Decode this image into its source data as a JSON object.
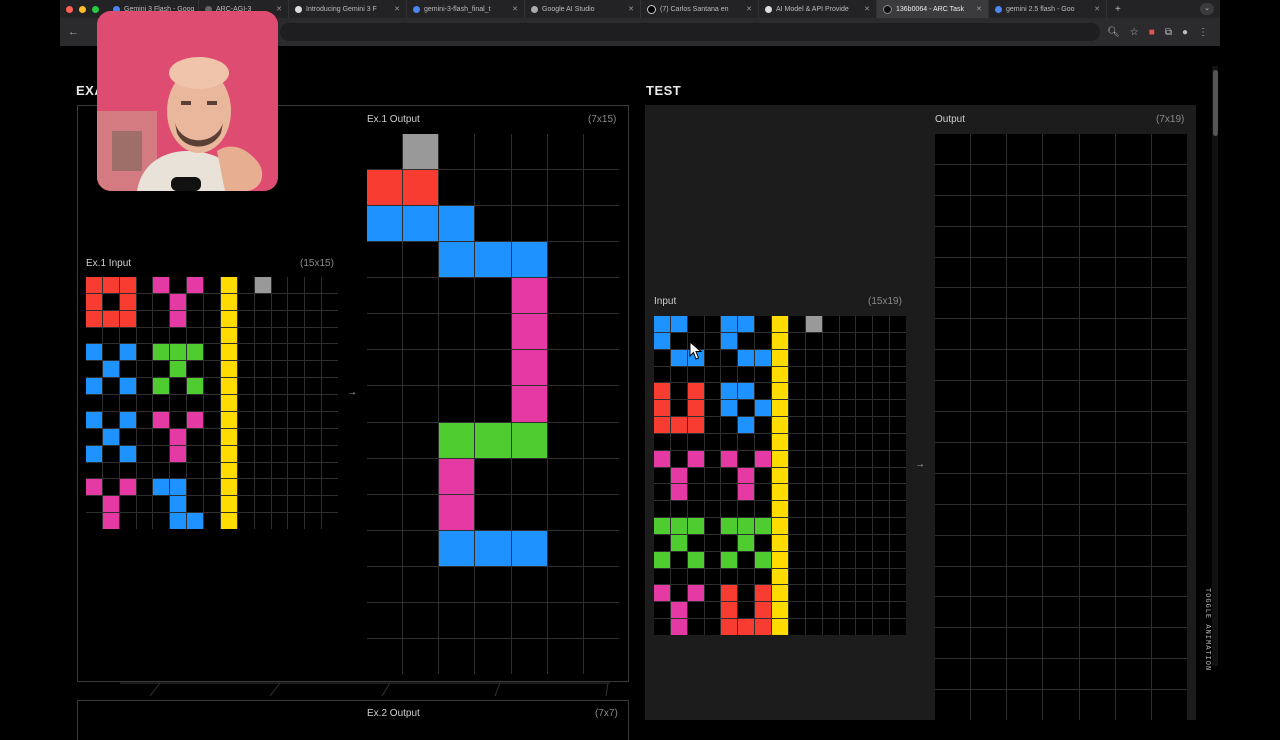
{
  "tabs": [
    {
      "label": "Gemini 3 Flash - Goog",
      "active": false
    },
    {
      "label": "ARC-AGI-3",
      "active": false
    },
    {
      "label": "Introducing Gemini 3 F",
      "active": false
    },
    {
      "label": "gemini-3-flash_final_t",
      "active": false
    },
    {
      "label": "Google AI Studio",
      "active": false
    },
    {
      "label": "(7) Carlos Santana en",
      "active": false
    },
    {
      "label": "AI Model & API Provide",
      "active": false
    },
    {
      "label": "136b0064 - ARC Task",
      "active": true
    },
    {
      "label": "gemini 2.5 flash - Goo",
      "active": false
    }
  ],
  "new_tab": "+",
  "sections": {
    "examples": "EXA",
    "test": "TEST"
  },
  "arrow": "→",
  "toggle_animation": "TOGGLE ANIMATION",
  "colors": {
    "0": "#000000",
    "1": "#1E93FF",
    "2": "#F93C31",
    "3": "#4FCC30",
    "4": "#FFDC00",
    "5": "#999999",
    "6": "#E53AA3",
    "7": "#FF851B",
    "8": "#87D8F1",
    "9": "#921231"
  },
  "grids": {
    "ex1_input": {
      "label": "Ex.1 Input",
      "dims": "(15x15)",
      "rows": [
        "222060604050000",
        "202006004000000",
        "222006004000000",
        "000000004000000",
        "101033304000000",
        "010003004000000",
        "101030304000000",
        "000000004000000",
        "101060604000000",
        "010006004000000",
        "101006004000000",
        "000000004000000",
        "606011004000000",
        "060001004000000",
        "060001104000000"
      ]
    },
    "ex1_output": {
      "label": "Ex.1 Output",
      "dims": "(7x15)",
      "rows": [
        "0500000",
        "2200000",
        "1110000",
        "0011100",
        "0000600",
        "0000600",
        "0000600",
        "0000600",
        "0033300",
        "0060000",
        "0060000",
        "0011100",
        "0000000",
        "0000000",
        "0000000"
      ]
    },
    "test_input": {
      "label": "Input",
      "dims": "(15x19)",
      "rows": [
        "110011040500000",
        "100010040000000",
        "011001140000000",
        "000000040000000",
        "202011040000000",
        "202010140000000",
        "222001040000000",
        "000000040000000",
        "606060640000000",
        "060006040000000",
        "060006040000000",
        "000000040000000",
        "333033340000000",
        "030003040000000",
        "303030340000000",
        "000000040000000",
        "606020240000000",
        "060020240000000",
        "060022240000000"
      ]
    },
    "test_output": {
      "label": "Output",
      "dims": "(7x19)",
      "rows": [
        "0000000",
        "0000000",
        "0000000",
        "0000000",
        "0000000",
        "0000000",
        "0000000",
        "0000000",
        "0000000",
        "0000000",
        "0000000",
        "0000000",
        "0000000",
        "0000000",
        "0000000",
        "0000000",
        "0000000",
        "0000000",
        "0000000"
      ]
    },
    "ex2_output": {
      "label": "Ex.2 Output",
      "dims": "(7x7)"
    }
  }
}
